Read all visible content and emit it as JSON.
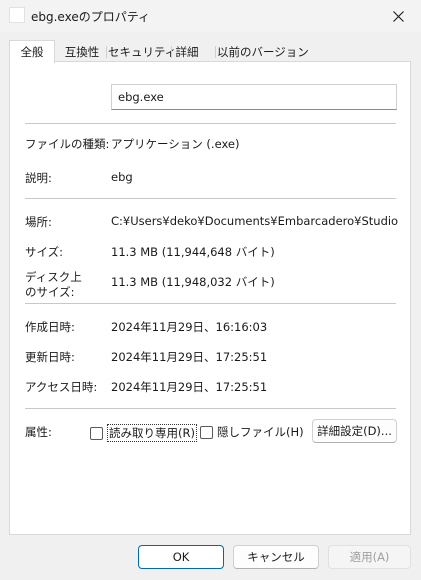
{
  "window": {
    "title": "ebg.exeのプロパティ"
  },
  "tabs": [
    {
      "label": "全般",
      "active": true
    },
    {
      "label": "互換性",
      "active": false
    },
    {
      "label": "セキュリティ",
      "active": false
    },
    {
      "label": "詳細",
      "active": false
    },
    {
      "label": "以前のバージョン",
      "active": false
    }
  ],
  "general": {
    "filename": "ebg.exe",
    "rows": {
      "file_type": {
        "label": "ファイルの種類:",
        "value": "アプリケーション (.exe)"
      },
      "description": {
        "label": "説明:",
        "value": "ebg"
      },
      "location": {
        "label": "場所:",
        "value": "C:¥Users¥deko¥Documents¥Embarcadero¥Studio¥Projects"
      },
      "size": {
        "label": "サイズ:",
        "value": "11.3 MB (11,944,648 バイト)"
      },
      "size_on_disk": {
        "label_line1": "ディスク上",
        "label_line2": "のサイズ:",
        "value": "11.3 MB (11,948,032 バイト)"
      },
      "created": {
        "label": "作成日時:",
        "value": "2024年11月29日、16:16:03"
      },
      "modified": {
        "label": "更新日時:",
        "value": "2024年11月29日、17:25:51"
      },
      "accessed": {
        "label": "アクセス日時:",
        "value": "2024年11月29日、17:25:51"
      }
    },
    "attributes": {
      "label": "属性:",
      "readonly": {
        "label": "読み取り専用(R)",
        "checked": false
      },
      "hidden": {
        "label": "隠しファイル(H)",
        "checked": false
      },
      "advanced_button": "詳細設定(D)..."
    }
  },
  "buttons": {
    "ok": "OK",
    "cancel": "キャンセル",
    "apply": "適用(A)"
  },
  "colors": {
    "ok_border": "#0067c0",
    "disabled_text": "#a0a0a0"
  }
}
